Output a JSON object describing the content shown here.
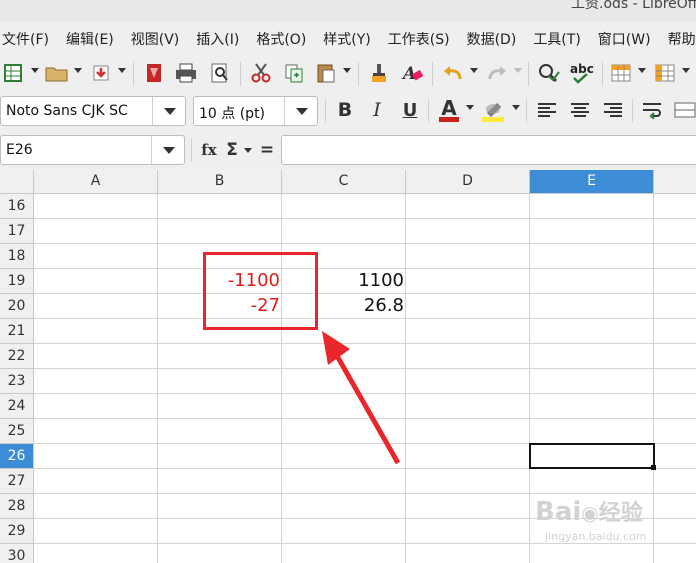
{
  "window": {
    "title": "工资.ods - LibreOff"
  },
  "menu": [
    "文件(F)",
    "编辑(E)",
    "视图(V)",
    "插入(I)",
    "格式(O)",
    "样式(Y)",
    "工作表(S)",
    "数据(D)",
    "工具(T)",
    "窗口(W)",
    "帮助"
  ],
  "toolbar": {
    "font_name": "Noto Sans CJK SC",
    "font_size": "10 点 (pt)",
    "icons": [
      "new-icon",
      "open-icon",
      "save-icon",
      "export-pdf-icon",
      "print-icon",
      "print-preview-icon",
      "cut-icon",
      "copy-icon",
      "paste-icon",
      "clone-format-icon",
      "clear-format-icon",
      "undo-icon",
      "redo-icon",
      "find-replace-icon",
      "spellcheck-icon",
      "row-icon",
      "column-icon"
    ],
    "format_icons": [
      "bold-icon",
      "italic-icon",
      "underline-icon",
      "font-color-icon",
      "highlight-icon",
      "align-left-icon",
      "align-center-icon",
      "align-right-icon",
      "wrap-text-icon"
    ],
    "bold": "B",
    "italic": "I",
    "underline": "U",
    "font_color": "A",
    "spellcheck": "abc"
  },
  "formula_bar": {
    "name_box": "E26",
    "function_wizard": "fx",
    "sum": "Σ",
    "equals": "=",
    "formula": ""
  },
  "sheet": {
    "columns": [
      "A",
      "B",
      "C",
      "D",
      "E"
    ],
    "selected_column": "E",
    "rows": [
      "16",
      "17",
      "18",
      "19",
      "20",
      "21",
      "22",
      "23",
      "24",
      "25",
      "26",
      "27",
      "28",
      "29",
      "30"
    ],
    "selected_row": "26",
    "cells": {
      "B19": "-1100",
      "B20": "-27",
      "C19": "1100",
      "C20": "26.8"
    },
    "active_cell": "E26"
  },
  "annotation": {
    "box_color": "#e8262b",
    "arrow_color": "#e8262b"
  },
  "watermark": {
    "brand": "Bai",
    "brand2": "经验",
    "url": "jingyan.baidu.com"
  },
  "colors": {
    "selected_header": "#3c8cd6",
    "negative_red": "#e01b1b"
  }
}
